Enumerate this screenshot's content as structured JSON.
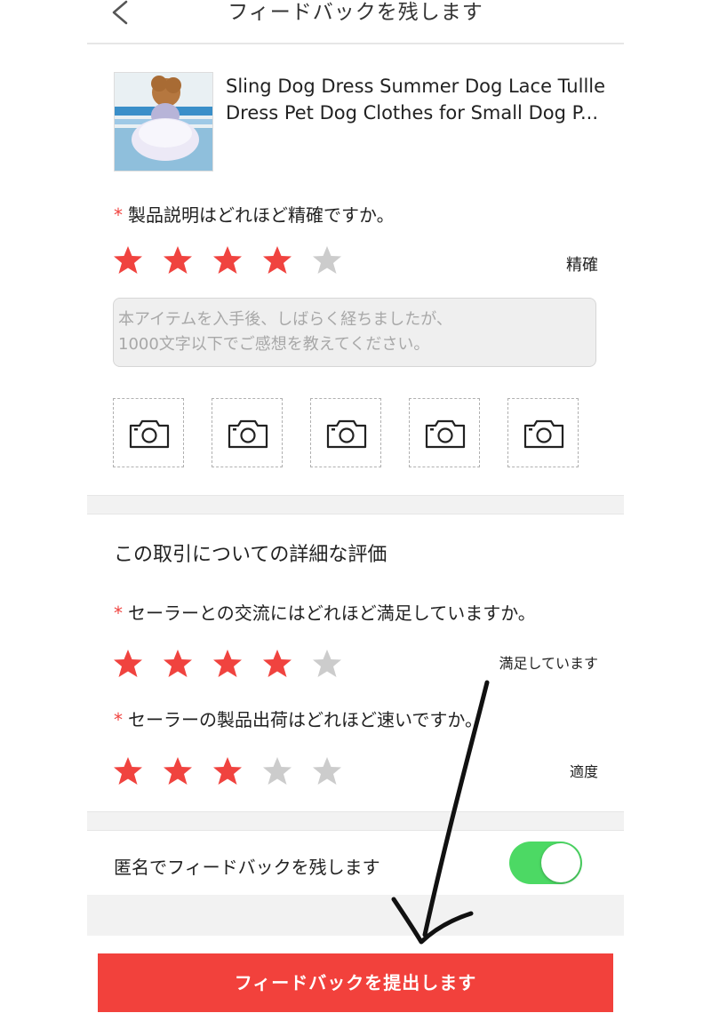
{
  "header": {
    "title": "フィードバックを残します"
  },
  "product": {
    "title": "Sling Dog Dress Summer Dog Lace Tullle Dress Pet Dog Clothes for Small Dog P..."
  },
  "description_question": {
    "required_mark": "*",
    "text": "製品説明はどれほど精確ですか。",
    "rating": 4,
    "max": 5,
    "label": "精確"
  },
  "comment": {
    "placeholder": "本アイテムを入手後、しばらく経ちましたが、\n1000文字以下でご感想を教えてください。"
  },
  "photo_slots": 5,
  "detail_section": {
    "title": "この取引についての詳細な評価"
  },
  "communication_question": {
    "required_mark": "*",
    "text": "セーラーとの交流にはどれほど満足していますか。",
    "rating": 4,
    "max": 5,
    "label": "満足しています"
  },
  "shipping_question": {
    "required_mark": "*",
    "text": "セーラーの製品出荷はどれほど速いですか。",
    "rating": 3,
    "max": 5,
    "label": "適度"
  },
  "anonymous": {
    "label": "匿名でフィードバックを残します",
    "enabled": true
  },
  "submit": {
    "label": "フィードバックを提出します"
  },
  "colors": {
    "star_on": "#f0433f",
    "star_off": "#cccccc",
    "accent": "#f2413c",
    "toggle_on": "#4cd964"
  }
}
